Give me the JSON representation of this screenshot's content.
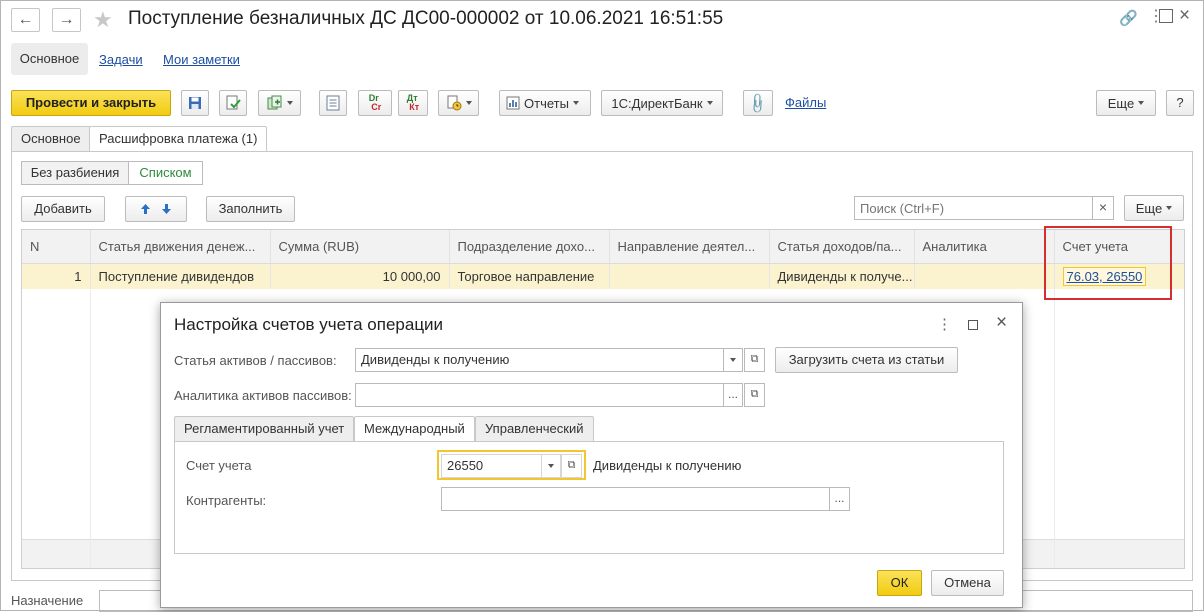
{
  "window": {
    "title": "Поступление безналичных ДС ДС00-000002 от 10.06.2021 16:51:55"
  },
  "top_nav": [
    {
      "label": "Основное"
    },
    {
      "label": "Задачи"
    },
    {
      "label": "Мои заметки"
    }
  ],
  "toolbar": {
    "post_close": "Провести и закрыть",
    "reports": "Отчеты",
    "directbank": "1С:ДиректБанк",
    "files": "Файлы",
    "more": "Еще",
    "help": "?"
  },
  "tabs": [
    {
      "label": "Основное"
    },
    {
      "label": "Расшифровка платежа (1)"
    }
  ],
  "split": {
    "no_split": "Без разбиения",
    "list": "Списком"
  },
  "table_toolbar": {
    "add": "Добавить",
    "fill": "Заполнить",
    "search_placeholder": "Поиск (Ctrl+F)",
    "clear": "×",
    "more": "Еще"
  },
  "table": {
    "columns": [
      "N",
      "Статья движения денеж...",
      "Сумма (RUB)",
      "Подразделение дохо...",
      "Направление деятел...",
      "Статья доходов/па...",
      "Аналитика",
      "Счет учета"
    ],
    "rows": [
      {
        "n": "1",
        "article": "Поступление дивидендов",
        "sum": "10 000,00",
        "division": "Торговое направление",
        "direction": "",
        "income": "Дивиденды к получе...",
        "analytics": "",
        "account": "76.03, 26550"
      }
    ]
  },
  "footer": {
    "purpose_label": "Назначение"
  },
  "dialog": {
    "title": "Настройка счетов учета операции",
    "asset_label": "Статья активов / пассивов:",
    "asset_value": "Дивиденды к получению",
    "load_button": "Загрузить счета из статьи",
    "analytics_label": "Аналитика активов пассивов:",
    "analytics_value": "",
    "tabs": [
      {
        "label": "Регламентированный учет"
      },
      {
        "label": "Международный"
      },
      {
        "label": "Управленческий"
      }
    ],
    "account_label": "Счет учета",
    "account_value": "26550",
    "account_desc": "Дивиденды к получению",
    "counterparties_label": "Контрагенты:",
    "counterparties_value": "",
    "ok": "ОК",
    "cancel": "Отмена"
  },
  "colors": {
    "primary_button": "#f5d21a",
    "selected_row": "#fbf2cf",
    "highlight_border": "#d32f2f",
    "link": "#1c4fa3",
    "focus_border": "#f2c72d"
  }
}
